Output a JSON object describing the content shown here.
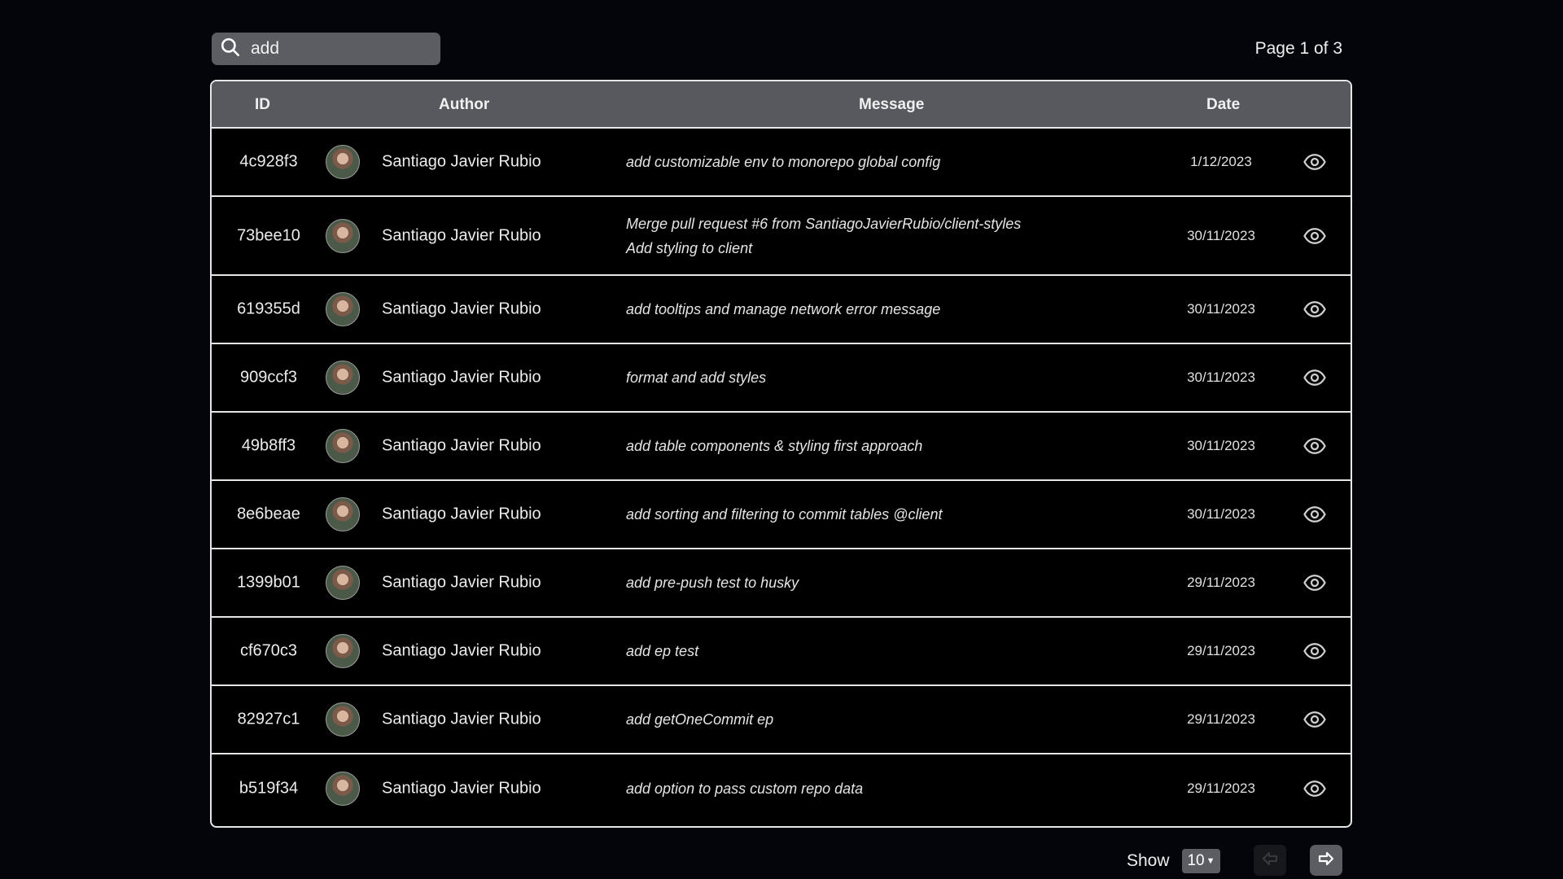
{
  "search": {
    "value": "add",
    "icon": "search-icon"
  },
  "pagination": {
    "indicator": "Page 1 of 3",
    "show_label": "Show",
    "page_size": "10"
  },
  "table": {
    "headers": {
      "id": "ID",
      "author": "Author",
      "message": "Message",
      "date": "Date"
    },
    "rows": [
      {
        "id": "4c928f3",
        "author": "Santiago Javier Rubio",
        "message": [
          "add customizable env to monorepo global config"
        ],
        "date": "1/12/2023"
      },
      {
        "id": "73bee10",
        "author": "Santiago Javier Rubio",
        "message": [
          "Merge pull request #6 from SantiagoJavierRubio/client-styles",
          "Add styling to client"
        ],
        "date": "30/11/2023"
      },
      {
        "id": "619355d",
        "author": "Santiago Javier Rubio",
        "message": [
          "add tooltips and manage network error message"
        ],
        "date": "30/11/2023"
      },
      {
        "id": "909ccf3",
        "author": "Santiago Javier Rubio",
        "message": [
          "format and add styles"
        ],
        "date": "30/11/2023"
      },
      {
        "id": "49b8ff3",
        "author": "Santiago Javier Rubio",
        "message": [
          "add table components & styling first approach"
        ],
        "date": "30/11/2023"
      },
      {
        "id": "8e6beae",
        "author": "Santiago Javier Rubio",
        "message": [
          "add sorting and filtering to commit tables @client"
        ],
        "date": "30/11/2023"
      },
      {
        "id": "1399b01",
        "author": "Santiago Javier Rubio",
        "message": [
          "add pre-push test to husky"
        ],
        "date": "29/11/2023"
      },
      {
        "id": "cf670c3",
        "author": "Santiago Javier Rubio",
        "message": [
          "add ep test"
        ],
        "date": "29/11/2023"
      },
      {
        "id": "82927c1",
        "author": "Santiago Javier Rubio",
        "message": [
          "add getOneCommit ep"
        ],
        "date": "29/11/2023"
      },
      {
        "id": "b519f34",
        "author": "Santiago Javier Rubio",
        "message": [
          "add option to pass custom repo data"
        ],
        "date": "29/11/2023"
      }
    ]
  },
  "icons": {
    "row_action": "eye-icon",
    "prev": "arrow-left-icon",
    "next": "arrow-right-icon"
  },
  "colors": {
    "background": "#04050a",
    "header_bg": "#57595f",
    "control_bg": "#5b5d63",
    "border": "#e6e6e6"
  }
}
